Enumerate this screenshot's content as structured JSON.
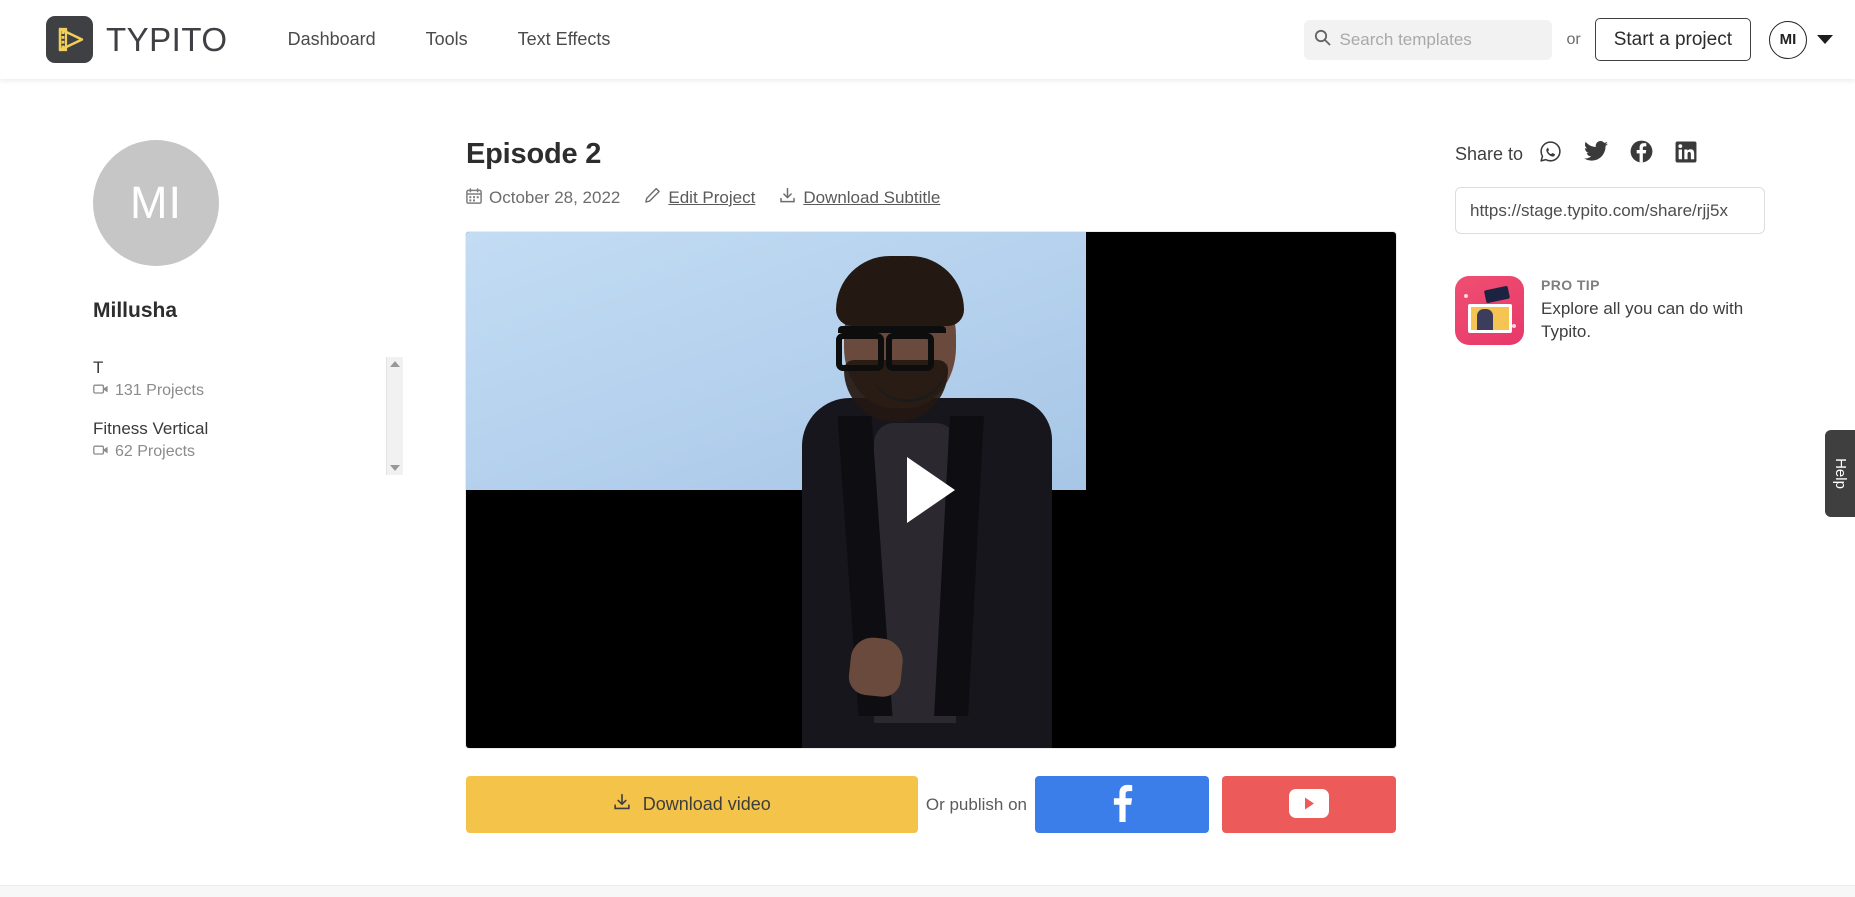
{
  "header": {
    "brand_name": "TYPITO",
    "logo_icon": "typito-film-play-logo",
    "nav": [
      {
        "label": "Dashboard"
      },
      {
        "label": "Tools"
      },
      {
        "label": "Text Effects"
      }
    ],
    "search": {
      "icon": "search-icon",
      "placeholder": "Search templates",
      "value": ""
    },
    "or_label": "or",
    "start_project_label": "Start a project",
    "avatar_initials": "MI",
    "caret_icon": "chevron-down-icon"
  },
  "sidebar": {
    "avatar_initials": "MI",
    "user_name": "Millusha",
    "projects": [
      {
        "title": "T",
        "count_label": "131 Projects",
        "icon": "video-camera-icon"
      },
      {
        "title": "Fitness Vertical",
        "count_label": "62 Projects",
        "icon": "video-camera-icon"
      }
    ],
    "scrollbar": {
      "up_icon": "scroll-up-arrow-icon",
      "down_icon": "scroll-down-arrow-icon"
    }
  },
  "main": {
    "project_title": "Episode 2",
    "date_icon": "calendar-icon",
    "date_label": "October 28, 2022",
    "edit_icon": "pencil-icon",
    "edit_label": "Edit Project",
    "subtitle_icon": "download-icon",
    "subtitle_label": "Download Subtitle",
    "video": {
      "play_icon": "play-triangle-icon",
      "state": "paused"
    },
    "actions": {
      "download_icon": "download-icon",
      "download_label": "Download video",
      "publish_label": "Or publish on",
      "facebook_icon": "facebook-icon",
      "youtube_icon": "youtube-icon"
    }
  },
  "share": {
    "label": "Share to",
    "icons": [
      {
        "name": "whatsapp-icon"
      },
      {
        "name": "twitter-icon"
      },
      {
        "name": "facebook-icon"
      },
      {
        "name": "linkedin-icon"
      }
    ],
    "url_value": "https://stage.typito.com/share/rjj5x",
    "pro_tip": {
      "icon": "pro-tip-illustration-icon",
      "title": "PRO TIP",
      "text": "Explore all you can do with Typito."
    }
  },
  "help": {
    "label": "Help"
  },
  "colors": {
    "brand_dark": "#3f4044",
    "brand_yellow": "#f3c449",
    "facebook_blue": "#3b7eea",
    "youtube_red": "#ec5a5a",
    "protip_pink": "#e8386a",
    "avatar_grey": "#c6c6c6"
  }
}
